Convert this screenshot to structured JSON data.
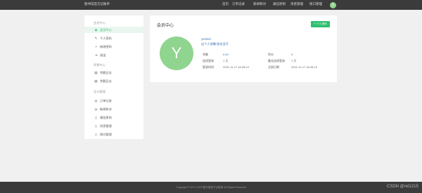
{
  "header": {
    "brand": "图书馆官方记账单",
    "nav": [
      "首页",
      "订单记录",
      "新闻和对",
      "通信原则",
      "消息管理",
      "接口管理"
    ],
    "avatar_letter": "Y"
  },
  "sidebar": {
    "groups": [
      {
        "title": "会员中心",
        "items": [
          {
            "label": "会员中心",
            "icon": "user-circle-icon",
            "active": true
          },
          {
            "label": "个人资料",
            "icon": "edit-icon",
            "active": false
          },
          {
            "label": "修改密码",
            "icon": "lock-icon",
            "active": false
          },
          {
            "label": "退出",
            "icon": "logout-icon",
            "active": false
          }
        ]
      },
      {
        "title": "积累中心",
        "items": [
          {
            "label": "余额日志",
            "icon": "list-icon",
            "active": false
          },
          {
            "label": "余额日志",
            "icon": "list-icon",
            "active": false
          }
        ]
      },
      {
        "title": "会计管理",
        "items": [
          {
            "label": "订单记录",
            "icon": "record-icon",
            "active": false
          },
          {
            "label": "新闻和对",
            "icon": "news-icon",
            "active": false
          },
          {
            "label": "通信原则",
            "icon": "doc-icon",
            "active": false
          },
          {
            "label": "消息管理",
            "icon": "doc-icon",
            "active": false
          },
          {
            "label": "接口管理",
            "icon": "doc-icon",
            "active": false
          }
        ]
      }
    ]
  },
  "main": {
    "title": "会员中心",
    "edit_button": "✎ 个人资料",
    "avatar_letter": "Y",
    "username": "yezisei",
    "intro": "这个人很懒,啥也没写",
    "info": {
      "balance_label": "余额",
      "balance_value": "0.00",
      "points_label": "积分",
      "points_value": "0",
      "login_label": "连续登录",
      "login_value": "1 天",
      "max_login_label": "最长连续登录",
      "max_login_value": "1 天",
      "last_login_label": "登录时间",
      "last_login_value": "2021-11-17 16:28:19",
      "register_label": "注册日期",
      "register_value": "2021-11-17 16:28:19"
    }
  },
  "footer": {
    "copyright": "Copyright © 2017-2020 图书馆官方记账单 All Rights Reserved",
    "watermark": "CSDN @rel1215"
  }
}
